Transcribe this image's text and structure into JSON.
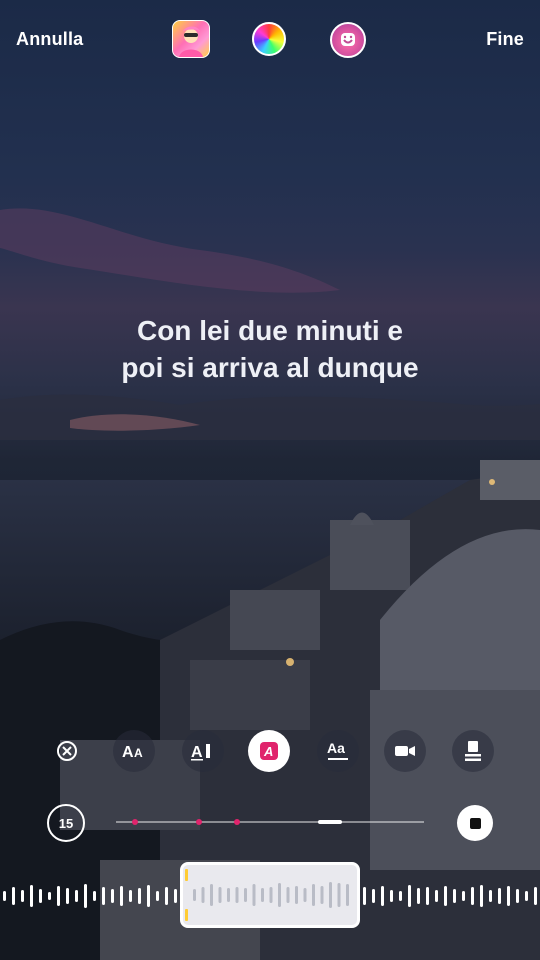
{
  "header": {
    "cancel_label": "Annulla",
    "done_label": "Fine",
    "thumbnail_icon": "album-cover-icon",
    "color_icon": "color-wheel-icon",
    "sticker_icon": "smile-face-icon"
  },
  "lyrics": {
    "line1": "Con lei due minuti e",
    "line2": "poi si arriva al dunque"
  },
  "tools": [
    {
      "name": "close-icon"
    },
    {
      "name": "font-size-icon",
      "label": "AA"
    },
    {
      "name": "text-cursor-icon",
      "label": "A"
    },
    {
      "name": "text-color-icon",
      "label": "A",
      "active": true
    },
    {
      "name": "text-style-icon",
      "label": "Aa"
    },
    {
      "name": "camera-icon"
    },
    {
      "name": "layout-icon"
    }
  ],
  "timeline": {
    "duration_label": "15",
    "accent_color": "#e0246c"
  }
}
